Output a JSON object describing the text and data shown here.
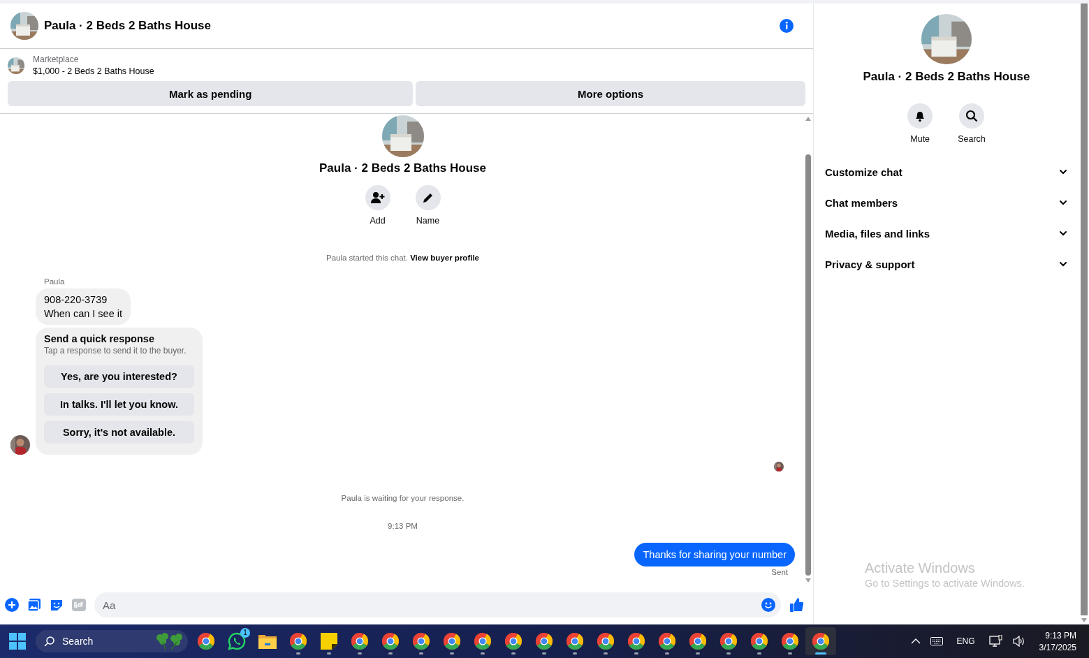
{
  "conversation": {
    "title": "Paula · 2 Beds 2 Baths House"
  },
  "listing": {
    "source": "Marketplace",
    "summary": "$1,000 - 2 Beds 2 Baths House",
    "actions": [
      "Mark as pending",
      "More options"
    ]
  },
  "chat_intro": {
    "title": "Paula · 2 Beds 2 Baths House",
    "actions": [
      {
        "kind": "add",
        "label": "Add"
      },
      {
        "kind": "name",
        "label": "Name"
      }
    ],
    "notice": "Paula started this chat.",
    "link": "View buyer profile"
  },
  "messages": [
    {
      "kind": "incoming",
      "sender": "Paula",
      "lines": [
        "908-220-3739",
        "When can I see it"
      ]
    },
    {
      "kind": "quick_response",
      "title": "Send a quick response",
      "hint": "Tap a response to send it to the buyer.",
      "options": [
        "Yes, are you interested?",
        "In talks. I'll let you know.",
        "Sorry, it's not available."
      ]
    },
    {
      "kind": "status",
      "text": "Paula is waiting for your response."
    },
    {
      "kind": "time",
      "text": "9:13 PM"
    },
    {
      "kind": "outgoing",
      "text": "Thanks for sharing your number",
      "status": "Sent"
    }
  ],
  "composer": {
    "placeholder": "Aa"
  },
  "details": {
    "title": "Paula · 2 Beds 2 Baths House",
    "actions": [
      {
        "kind": "mute",
        "label": "Mute"
      },
      {
        "kind": "search",
        "label": "Search"
      }
    ],
    "sections": [
      {
        "label": "Customize chat",
        "expanded": false
      },
      {
        "label": "Chat members",
        "expanded": false
      },
      {
        "label": "Media, files and links",
        "expanded": false
      },
      {
        "label": "Privacy & support",
        "expanded": false
      }
    ]
  },
  "overlay": {
    "title": "Activate Windows",
    "subtitle": "Go to Settings to activate Windows."
  },
  "taskbar": {
    "search_placeholder": "Search",
    "apps": [
      {
        "kind": "chrome",
        "running": false,
        "selected": false
      },
      {
        "kind": "whatsapp",
        "badge": "1",
        "running": false,
        "selected": false
      },
      {
        "kind": "folder",
        "running": false,
        "selected": false
      },
      {
        "kind": "chrome",
        "running": true,
        "selected": false
      },
      {
        "kind": "notes",
        "running": true,
        "selected": false
      },
      {
        "kind": "chrome",
        "running": true,
        "selected": false
      },
      {
        "kind": "chrome",
        "running": true,
        "selected": false
      },
      {
        "kind": "chrome",
        "running": true,
        "selected": false
      },
      {
        "kind": "chrome",
        "running": true,
        "selected": false
      },
      {
        "kind": "chrome",
        "running": true,
        "selected": false
      },
      {
        "kind": "chrome",
        "running": true,
        "selected": false
      },
      {
        "kind": "chrome",
        "running": true,
        "selected": false
      },
      {
        "kind": "chrome",
        "running": true,
        "selected": false
      },
      {
        "kind": "chrome",
        "running": true,
        "selected": false
      },
      {
        "kind": "chrome",
        "running": true,
        "selected": false
      },
      {
        "kind": "chrome",
        "running": true,
        "selected": false
      },
      {
        "kind": "chrome",
        "running": true,
        "selected": false
      },
      {
        "kind": "chrome",
        "running": true,
        "selected": false
      },
      {
        "kind": "chrome",
        "running": true,
        "selected": false
      },
      {
        "kind": "chrome",
        "running": true,
        "selected": false
      },
      {
        "kind": "chrome",
        "running": true,
        "selected": true
      }
    ],
    "tray": {
      "language": "ENG",
      "time": "9:13 PM",
      "date": "3/17/2025"
    }
  }
}
